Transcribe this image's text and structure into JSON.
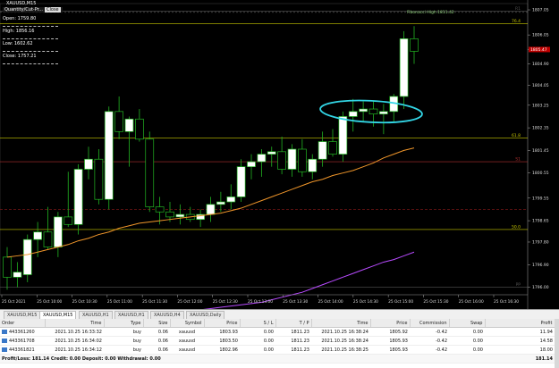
{
  "window": {
    "symbol_title": "XAUUSD,M15",
    "panel_title": "Quantity/Cut-Pr...",
    "panel_button": "Close"
  },
  "ohlc": {
    "open": "Open: 1759.80",
    "high": "High: 1856.16",
    "low": "Low: 1602.62",
    "close": "Close: 1757.21"
  },
  "chart_data": {
    "type": "candlestick",
    "price_axis": [
      "1807.05",
      "1806.05",
      "1805.47",
      "1804.90",
      "1804.05",
      "1803.25",
      "1802.35",
      "1801.45",
      "1800.55",
      "1799.55",
      "1798.65",
      "1797.80",
      "1796.90",
      "1796.00"
    ],
    "current_price": "1805.47",
    "time_axis": [
      "25 Oct 2021",
      "25 Oct 10:00",
      "25 Oct 10:30",
      "25 Oct 11:00",
      "25 Oct 11:30",
      "25 Oct 12:00",
      "25 Oct 12:30",
      "25 Oct 13:00",
      "25 Oct 13:30",
      "25 Oct 14:00",
      "25 Oct 14:30",
      "25 Oct 15:00",
      "25 Oct 15:30",
      "25 Oct 16:00",
      "25 Oct 16:30"
    ],
    "levels": [
      {
        "label": "76.4",
        "price": 1806.5,
        "color": "#c8c800"
      },
      {
        "label": "61.8",
        "price": 1801.95,
        "color": "#c8c800"
      },
      {
        "label": "50.0",
        "price": 1798.3,
        "color": "#c8c800"
      },
      {
        "label": "R1",
        "price": 1807.0,
        "color": "#555"
      },
      {
        "label": "PP",
        "price": 1796.0,
        "color": "#555"
      },
      {
        "label": "S1",
        "price": 1801.0,
        "color": "#b03030"
      }
    ],
    "fibo_label": "Fibonacci High 1811.42",
    "candles": [
      {
        "o": 1797.2,
        "h": 1797.6,
        "l": 1795.9,
        "c": 1796.4
      },
      {
        "o": 1796.4,
        "h": 1797.0,
        "l": 1796.0,
        "c": 1796.6
      },
      {
        "o": 1796.5,
        "h": 1798.1,
        "l": 1796.2,
        "c": 1797.9
      },
      {
        "o": 1797.9,
        "h": 1798.6,
        "l": 1797.2,
        "c": 1798.2
      },
      {
        "o": 1798.2,
        "h": 1799.2,
        "l": 1797.5,
        "c": 1797.6
      },
      {
        "o": 1797.6,
        "h": 1799.0,
        "l": 1797.2,
        "c": 1798.8
      },
      {
        "o": 1798.8,
        "h": 1800.6,
        "l": 1798.4,
        "c": 1798.5
      },
      {
        "o": 1798.5,
        "h": 1800.9,
        "l": 1798.1,
        "c": 1800.7
      },
      {
        "o": 1800.7,
        "h": 1801.6,
        "l": 1800.3,
        "c": 1801.1
      },
      {
        "o": 1801.1,
        "h": 1801.5,
        "l": 1799.3,
        "c": 1799.5
      },
      {
        "o": 1799.5,
        "h": 1803.2,
        "l": 1799.1,
        "c": 1803.0
      },
      {
        "o": 1803.0,
        "h": 1803.6,
        "l": 1801.9,
        "c": 1802.2
      },
      {
        "o": 1802.2,
        "h": 1802.8,
        "l": 1800.8,
        "c": 1802.7
      },
      {
        "o": 1802.7,
        "h": 1803.1,
        "l": 1801.8,
        "c": 1801.9
      },
      {
        "o": 1801.9,
        "h": 1802.2,
        "l": 1799.0,
        "c": 1799.2
      },
      {
        "o": 1799.2,
        "h": 1799.6,
        "l": 1798.5,
        "c": 1799.0
      },
      {
        "o": 1799.0,
        "h": 1799.4,
        "l": 1798.6,
        "c": 1798.8
      },
      {
        "o": 1798.8,
        "h": 1799.3,
        "l": 1798.5,
        "c": 1798.9
      },
      {
        "o": 1798.9,
        "h": 1799.2,
        "l": 1798.6,
        "c": 1798.7
      },
      {
        "o": 1798.7,
        "h": 1799.1,
        "l": 1798.4,
        "c": 1798.9
      },
      {
        "o": 1798.9,
        "h": 1799.6,
        "l": 1798.6,
        "c": 1799.3
      },
      {
        "o": 1799.3,
        "h": 1799.8,
        "l": 1799.0,
        "c": 1799.4
      },
      {
        "o": 1799.4,
        "h": 1800.1,
        "l": 1799.1,
        "c": 1799.6
      },
      {
        "o": 1799.6,
        "h": 1801.1,
        "l": 1799.4,
        "c": 1800.8
      },
      {
        "o": 1800.8,
        "h": 1801.3,
        "l": 1800.3,
        "c": 1801.0
      },
      {
        "o": 1801.0,
        "h": 1801.5,
        "l": 1800.4,
        "c": 1801.3
      },
      {
        "o": 1801.3,
        "h": 1801.6,
        "l": 1800.8,
        "c": 1801.4
      },
      {
        "o": 1801.4,
        "h": 1802.0,
        "l": 1800.5,
        "c": 1800.7
      },
      {
        "o": 1800.7,
        "h": 1801.7,
        "l": 1800.4,
        "c": 1801.5
      },
      {
        "o": 1801.5,
        "h": 1801.9,
        "l": 1800.4,
        "c": 1800.6
      },
      {
        "o": 1800.6,
        "h": 1801.3,
        "l": 1800.3,
        "c": 1801.1
      },
      {
        "o": 1801.1,
        "h": 1802.2,
        "l": 1800.8,
        "c": 1801.8
      },
      {
        "o": 1801.8,
        "h": 1802.3,
        "l": 1801.2,
        "c": 1801.3
      },
      {
        "o": 1801.3,
        "h": 1803.0,
        "l": 1801.0,
        "c": 1802.8
      },
      {
        "o": 1802.8,
        "h": 1803.5,
        "l": 1802.2,
        "c": 1803.0
      },
      {
        "o": 1803.0,
        "h": 1803.4,
        "l": 1802.6,
        "c": 1803.1
      },
      {
        "o": 1803.1,
        "h": 1803.4,
        "l": 1802.4,
        "c": 1802.9
      },
      {
        "o": 1802.9,
        "h": 1803.3,
        "l": 1802.1,
        "c": 1803.0
      },
      {
        "o": 1803.0,
        "h": 1803.7,
        "l": 1802.6,
        "c": 1803.6
      },
      {
        "o": 1803.6,
        "h": 1806.2,
        "l": 1803.1,
        "c": 1805.9
      },
      {
        "o": 1805.9,
        "h": 1806.4,
        "l": 1804.9,
        "c": 1805.4
      }
    ],
    "ma_orange": [
      1797.2,
      1797.25,
      1797.3,
      1797.4,
      1797.5,
      1797.6,
      1797.7,
      1797.85,
      1797.95,
      1798.1,
      1798.2,
      1798.35,
      1798.45,
      1798.55,
      1798.6,
      1798.65,
      1798.7,
      1798.75,
      1798.8,
      1798.85,
      1798.9,
      1798.95,
      1799.05,
      1799.15,
      1799.3,
      1799.45,
      1799.6,
      1799.75,
      1799.9,
      1800.05,
      1800.2,
      1800.3,
      1800.45,
      1800.55,
      1800.65,
      1800.8,
      1800.95,
      1801.15,
      1801.3,
      1801.45,
      1801.55
    ],
    "ma_purple": [
      1795.0,
      1795.05,
      1795.1,
      1795.15,
      1795.2,
      1795.25,
      1795.3,
      1795.35,
      1795.4,
      1795.5,
      1795.6,
      1795.7,
      1795.8,
      1795.95,
      1796.1,
      1796.25,
      1796.4,
      1796.55,
      1796.7,
      1796.85,
      1797.0,
      1797.1,
      1797.25,
      1797.4
    ],
    "ellipse_color": "#33d6e6",
    "bull_color": "#ffffff",
    "bear_color": "#000000",
    "wick_color": "#22b522"
  },
  "tabs": [
    {
      "label": "XAUUSD,M15",
      "active": false
    },
    {
      "label": "XAUUSD,M15",
      "active": true
    },
    {
      "label": "XAUUSD,H1",
      "active": false
    },
    {
      "label": "XAUUSD,H1",
      "active": false
    },
    {
      "label": "XAUUSD,H4",
      "active": false
    },
    {
      "label": "XAUUSD,Daily",
      "active": false
    }
  ],
  "orders": {
    "headers": [
      "Order",
      "Time",
      "Type",
      "Size",
      "Symbol",
      "Price",
      "S / L",
      "T / P",
      "Time",
      "Price",
      "Commission",
      "Swap",
      "Profit"
    ],
    "rows": [
      [
        "443361260",
        "2021.10.25 16:33:32",
        "buy",
        "0.06",
        "xauusd",
        "1803.93",
        "0.00",
        "1811.23",
        "2021.10.25 16:38:24",
        "1805.92",
        "-0.42",
        "0.00",
        "11.94"
      ],
      [
        "443361708",
        "2021.10.25 16:34:02",
        "buy",
        "0.06",
        "xauusd",
        "1803.50",
        "0.00",
        "1811.23",
        "2021.10.25 16:38:24",
        "1805.93",
        "-0.42",
        "0.00",
        "14.58"
      ],
      [
        "443361821",
        "2021.10.25 16:34:12",
        "buy",
        "0.06",
        "xauusd",
        "1802.96",
        "0.00",
        "1811.23",
        "2021.10.25 16:38:25",
        "1805.93",
        "-0.42",
        "0.00",
        "18.00"
      ]
    ],
    "summary": "Profit/Loss: 181.14  Credit: 0.00  Deposit: 0.00  Withdrawal: 0.00",
    "total": "181.14"
  }
}
